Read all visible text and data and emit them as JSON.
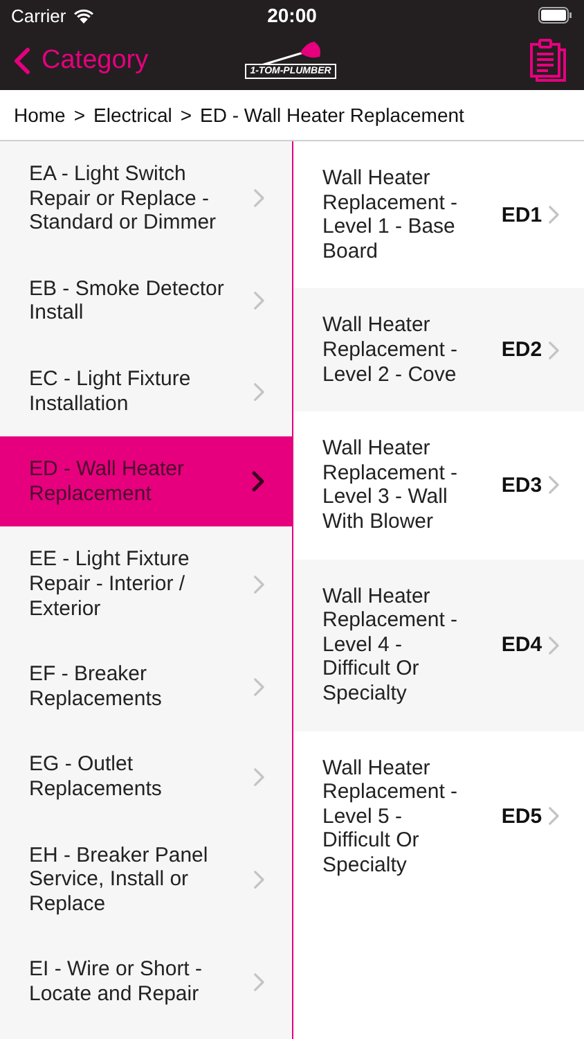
{
  "status_bar": {
    "carrier": "Carrier",
    "time": "20:00"
  },
  "nav_bar": {
    "back_label": "Category",
    "logo_text": "1-TOM-PLUMBER"
  },
  "breadcrumb": [
    "Home",
    "Electrical",
    "ED - Wall Heater Replacement"
  ],
  "breadcrumb_separator": ">",
  "categories": [
    {
      "label": "EA - Light Switch Repair or Replace - Standard or Dimmer",
      "selected": false
    },
    {
      "label": "EB - Smoke Detector Install",
      "selected": false
    },
    {
      "label": "EC - Light Fixture Installation",
      "selected": false
    },
    {
      "label": "ED - Wall Heater Replacement",
      "selected": true
    },
    {
      "label": "EE - Light Fixture Repair - Interior / Exterior",
      "selected": false
    },
    {
      "label": "EF - Breaker Replacements",
      "selected": false
    },
    {
      "label": "EG - Outlet Replacements",
      "selected": false
    },
    {
      "label": "EH - Breaker Panel Service, Install or Replace",
      "selected": false
    },
    {
      "label": "EI - Wire or Short - Locate and Repair",
      "selected": false
    }
  ],
  "services": [
    {
      "title": "Wall Heater Replacement - Level 1 - Base Board",
      "code": "ED1"
    },
    {
      "title": "Wall Heater Replacement - Level 2 - Cove",
      "code": "ED2"
    },
    {
      "title": "Wall Heater Replacement - Level 3 - Wall With Blower",
      "code": "ED3"
    },
    {
      "title": "Wall Heater Replacement - Level 4 - Difficult Or Specialty",
      "code": "ED4"
    },
    {
      "title": "Wall Heater Replacement - Level 5 - Difficult Or Specialty",
      "code": "ED5"
    }
  ]
}
